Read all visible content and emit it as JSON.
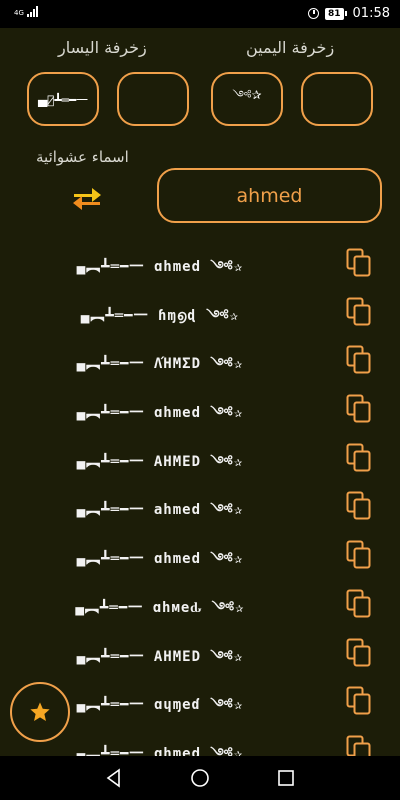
{
  "status_bar": {
    "network": "4G",
    "battery": "81",
    "time": "01:58"
  },
  "decoration": {
    "left_label": "زخرفة اليسار",
    "right_label": "زخرفة اليمين",
    "left_boxes": [
      "▄︻̷┻═━一",
      ""
    ],
    "right_boxes": [
      "༺✰",
      ""
    ]
  },
  "random_names_label": "اسماء عشوائية",
  "name_input": {
    "value": "ahmed",
    "placeholder": ""
  },
  "results": [
    "▄︻┻═━一 ɑhmed ༺✰",
    "▄︻┻═━一 ɦɱ൭ɖ ༺✰",
    "▄︻┻═━一 ΛΉMΣD ༺✰",
    "▄︻┻═━一 ɑhmed ༺✰",
    "▄︻┻═━一 AHMED ༺✰",
    "▄︻┻═━一 ahmed ༺✰",
    "▄︻┻═━一 ɑhmed ༺✰",
    "▄︻┻═━一 ɑhмeԃ ༺✰",
    "▄︻┻═━一 ΑΗΜΕD ༺✰",
    "▄︻┻═━一 ɑɥɱeɗ ༺✰",
    "▄︻┻═━一 ɑhmed ༺✰"
  ],
  "colors": {
    "accent": "#f0a04a",
    "background": "#1c1d08",
    "refresh_yellow": "#f5c518",
    "refresh_orange": "#f08c1e"
  },
  "icons": {
    "copy": "copy-icon",
    "refresh": "refresh-icon",
    "fab": "star-icon"
  }
}
